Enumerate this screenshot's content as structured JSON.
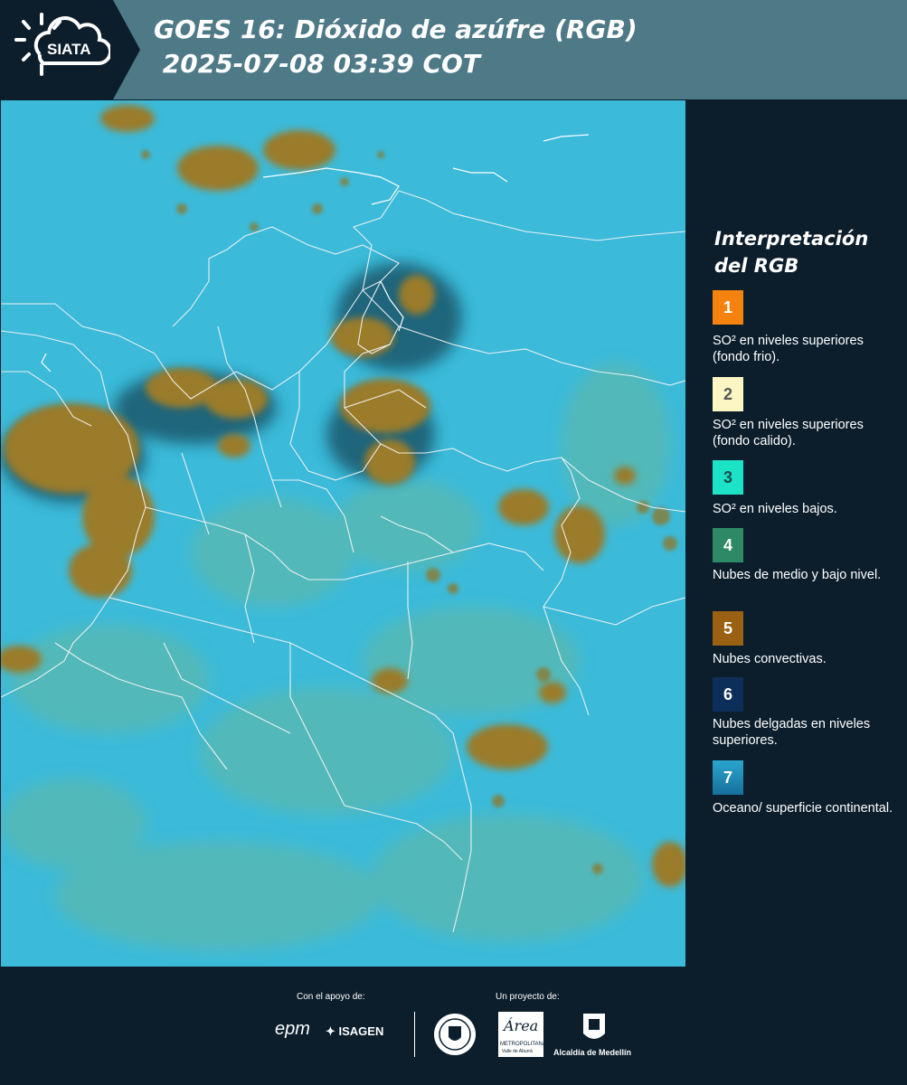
{
  "header": {
    "logo_text": "SIATA",
    "title": "GOES 16: Dióxido de azúfre (RGB)\n 2025-07-08 03:39 COT"
  },
  "legend": {
    "title": "Interpretación\ndel RGB",
    "items": [
      {
        "number": "1",
        "color": "#f5820f",
        "text": "SO² en niveles superiores (fondo frio)."
      },
      {
        "number": "2",
        "color": "#fbf6c4",
        "text": "SO² en niveles superiores (fondo calido)."
      },
      {
        "number": "3",
        "color": "#1de3c6",
        "text": "SO² en niveles bajos."
      },
      {
        "number": "4",
        "color": "#2e8a66",
        "text": "Nubes de medio y bajo nivel."
      },
      {
        "number": "5",
        "color": "#9a6112",
        "text": "Nubes convectivas."
      },
      {
        "number": "6",
        "color": "#0c2f5a",
        "text": "Nubes delgadas en niveles superiores."
      },
      {
        "number": "7",
        "color": "#1f8fc0",
        "text": "Oceano/ superficie continental."
      }
    ]
  },
  "footer": {
    "support_label": "Con el apoyo de:",
    "project_label": "Un proyecto de:",
    "sponsor_epm": "epm",
    "sponsor_isagen": "ISAGEN",
    "area_text": "Área",
    "area_sub": "METROPOLITANA",
    "area_sub2": "Valle de Aburrá",
    "alcaldia": "Alcaldía de Medellín"
  },
  "colors": {
    "background": "#0c1e2c",
    "header_band": "#4e7987",
    "map_base": "#38b7d8",
    "cloud_convective": "#9a7a2a",
    "cloud_low": "#5db59a"
  }
}
